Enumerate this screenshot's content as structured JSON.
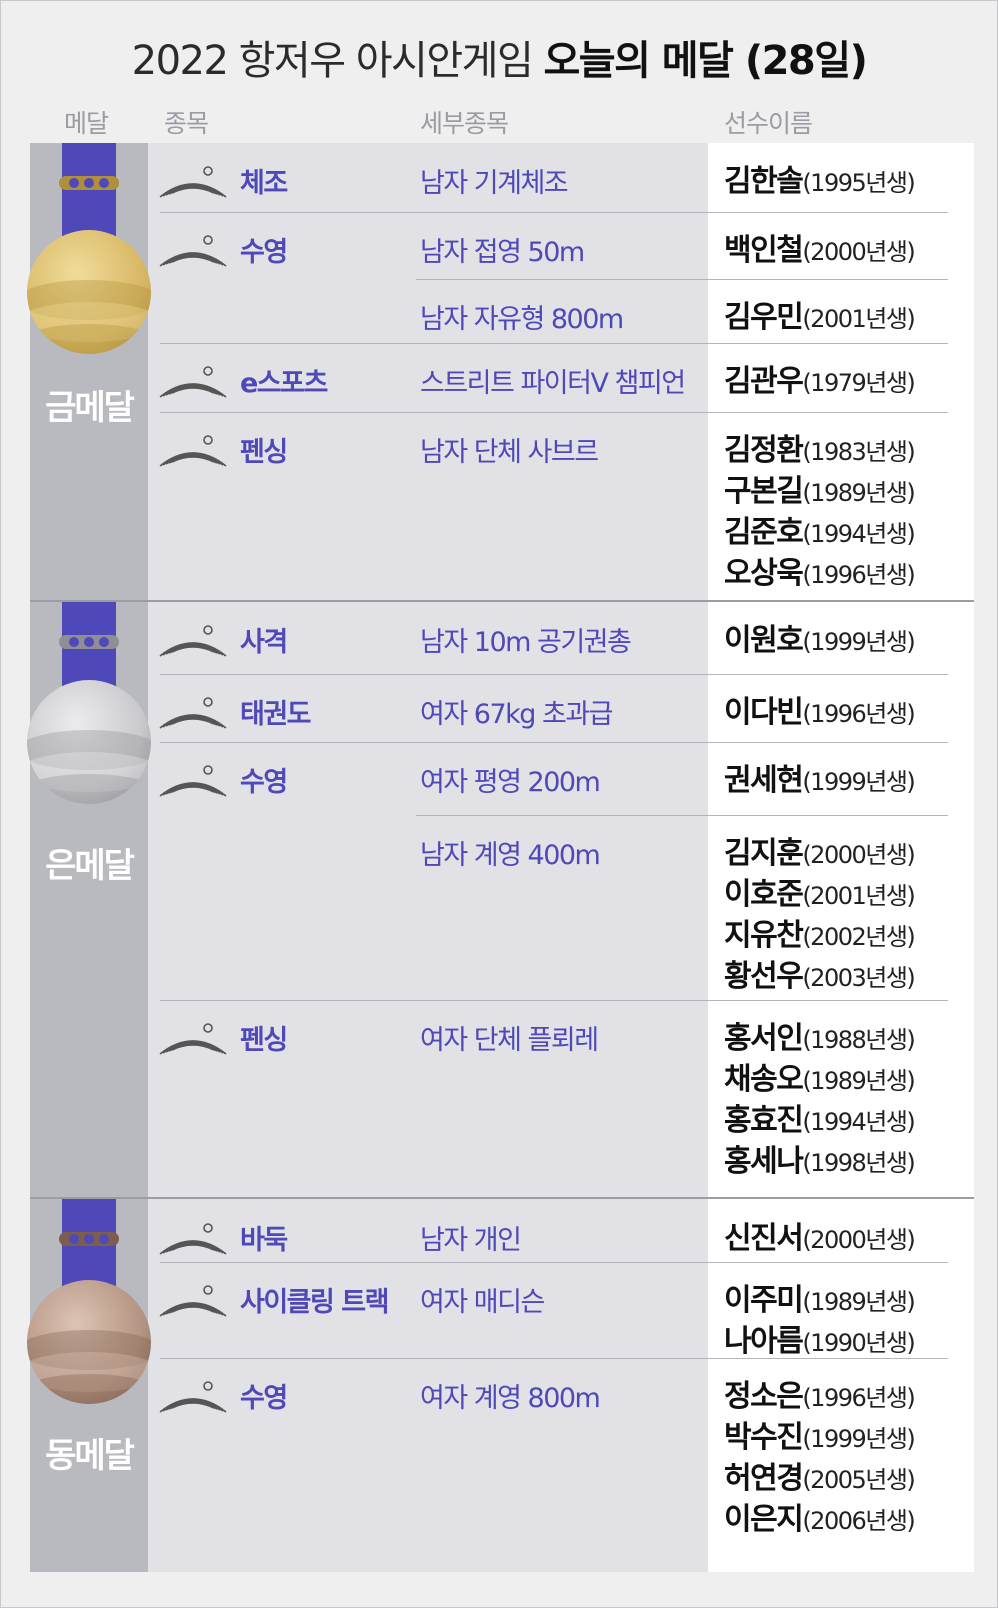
{
  "title": {
    "light": "2022 항저우 아시안게임 ",
    "bold": "오늘의 메달 (28일)"
  },
  "headers": {
    "medal": "메달",
    "sport": "종목",
    "event": "세부종목",
    "athlete": "선수이름"
  },
  "colors": {
    "accent": "#4f48b8",
    "gold": "#d8b866",
    "silver": "#c9c9cc",
    "bronze": "#b49482",
    "medal_band": "#b9b9c0",
    "content_bg": "#e2e2e6"
  },
  "medals": {
    "gold": "금메달",
    "silver": "은메달",
    "bronze": "동메달"
  },
  "rows": [
    {
      "medal": "gold",
      "icon": "gymnastics-icon",
      "sport": "체조",
      "event": "남자 기계체조",
      "athletes": [
        {
          "name": "김한솔",
          "year": "(1995년생)"
        }
      ]
    },
    {
      "medal": "gold",
      "icon": "swimming-icon",
      "sport": "수영",
      "event": "남자 접영 50m",
      "athletes": [
        {
          "name": "백인철",
          "year": "(2000년생)"
        }
      ]
    },
    {
      "medal": "gold",
      "icon": "",
      "sport": "",
      "event": "남자 자유형 800m",
      "athletes": [
        {
          "name": "김우민",
          "year": "(2001년생)"
        }
      ]
    },
    {
      "medal": "gold",
      "icon": "esports-icon",
      "sport": "e스포츠",
      "event": "스트리트 파이터V 챔피언",
      "athletes": [
        {
          "name": "김관우",
          "year": "(1979년생)"
        }
      ]
    },
    {
      "medal": "gold",
      "icon": "fencing-icon",
      "sport": "펜싱",
      "event": "남자 단체 사브르",
      "athletes": [
        {
          "name": "김정환",
          "year": "(1983년생)"
        },
        {
          "name": "구본길",
          "year": "(1989년생)"
        },
        {
          "name": "김준호",
          "year": "(1994년생)"
        },
        {
          "name": "오상욱",
          "year": "(1996년생)"
        }
      ]
    },
    {
      "medal": "silver",
      "icon": "shooting-icon",
      "sport": "사격",
      "event": "남자 10m 공기권총",
      "athletes": [
        {
          "name": "이원호",
          "year": "(1999년생)"
        }
      ]
    },
    {
      "medal": "silver",
      "icon": "taekwondo-icon",
      "sport": "태권도",
      "event": "여자 67kg 초과급",
      "athletes": [
        {
          "name": "이다빈",
          "year": "(1996년생)"
        }
      ]
    },
    {
      "medal": "silver",
      "icon": "swimming-icon",
      "sport": "수영",
      "event": "여자 평영 200m",
      "athletes": [
        {
          "name": "권세현",
          "year": "(1999년생)"
        }
      ]
    },
    {
      "medal": "silver",
      "icon": "",
      "sport": "",
      "event": "남자 계영 400m",
      "athletes": [
        {
          "name": "김지훈",
          "year": "(2000년생)"
        },
        {
          "name": "이호준",
          "year": "(2001년생)"
        },
        {
          "name": "지유찬",
          "year": "(2002년생)"
        },
        {
          "name": "황선우",
          "year": "(2003년생)"
        }
      ]
    },
    {
      "medal": "silver",
      "icon": "fencing-icon",
      "sport": "펜싱",
      "event": "여자 단체 플뢰레",
      "athletes": [
        {
          "name": "홍서인",
          "year": "(1988년생)"
        },
        {
          "name": "채송오",
          "year": "(1989년생)"
        },
        {
          "name": "홍효진",
          "year": "(1994년생)"
        },
        {
          "name": "홍세나",
          "year": "(1998년생)"
        }
      ]
    },
    {
      "medal": "bronze",
      "icon": "baduk-icon",
      "sport": "바둑",
      "event": "남자 개인",
      "athletes": [
        {
          "name": "신진서",
          "year": "(2000년생)"
        }
      ]
    },
    {
      "medal": "bronze",
      "icon": "cycling-icon",
      "sport": "사이클링 트랙",
      "event": "여자 매디슨",
      "athletes": [
        {
          "name": "이주미",
          "year": "(1989년생)"
        },
        {
          "name": "나아름",
          "year": "(1990년생)"
        }
      ]
    },
    {
      "medal": "bronze",
      "icon": "swimming-icon",
      "sport": "수영",
      "event": "여자 계영 800m",
      "athletes": [
        {
          "name": "정소은",
          "year": "(1996년생)"
        },
        {
          "name": "박수진",
          "year": "(1999년생)"
        },
        {
          "name": "허연경",
          "year": "(2005년생)"
        },
        {
          "name": "이은지",
          "year": "(2006년생)"
        }
      ]
    }
  ]
}
